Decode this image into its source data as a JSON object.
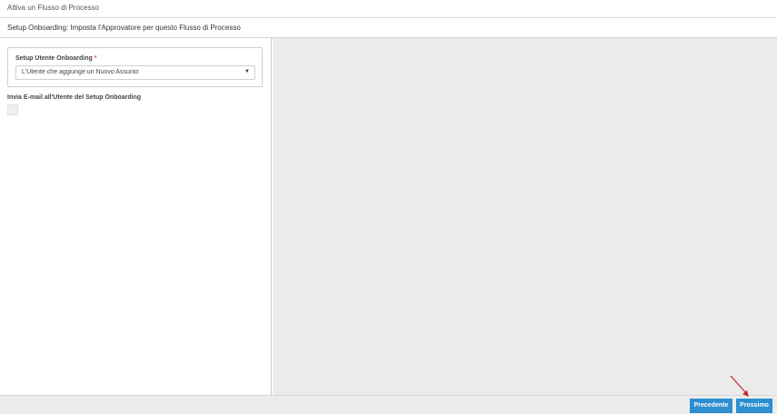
{
  "window": {
    "title": "Attiva un Flusso di Processo"
  },
  "section": {
    "title": "Setup Onboarding: Imposta l'Approvatore per questo Flusso di Processo"
  },
  "form": {
    "setup_user_label": "Setup Utente Onboarding",
    "required_marker": "*",
    "setup_user_value": "L'Utente che aggiunge un Nuovo Assunto",
    "send_email_label": "Invia E-mail all'Utente del Setup Onboarding",
    "send_email_checked": false
  },
  "footer": {
    "prev_label": "Precedente",
    "next_label": "Prossimo"
  },
  "colors": {
    "button": "#2e8fd0",
    "required": "#d9534f",
    "annotation_arrow": "#d0202a",
    "right_pane": "#ebebeb"
  },
  "icons": {
    "dropdown": "chevron-down-icon",
    "annotation": "red-arrow-icon"
  }
}
